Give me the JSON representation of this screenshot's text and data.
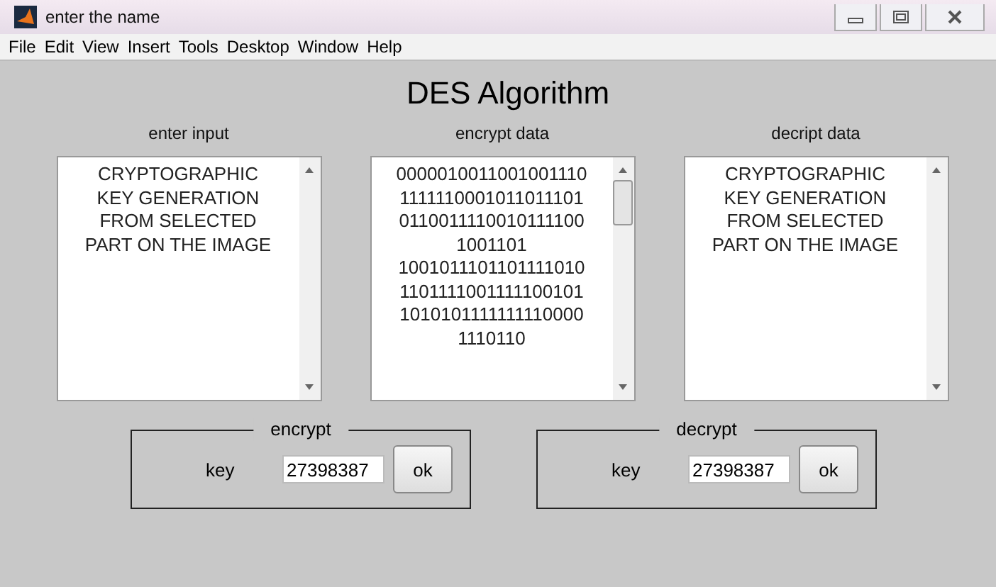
{
  "window": {
    "title": "enter the name"
  },
  "menu": [
    "File",
    "Edit",
    "View",
    "Insert",
    "Tools",
    "Desktop",
    "Window",
    "Help"
  ],
  "heading": "DES Algorithm",
  "panels": [
    {
      "label": "enter input",
      "lines": [
        "CRYPTOGRAPHIC",
        "KEY GENERATION",
        "FROM SELECTED",
        "PART ON THE IMAGE"
      ],
      "scroll_thumb": false
    },
    {
      "label": "encrypt data",
      "lines": [
        "0000010011001001110",
        "1111110001011011101",
        "0110011110010111100",
        "1001101",
        "1001011101101111010",
        "1101111001111100101",
        "1010101111111110000",
        "1110110"
      ],
      "scroll_thumb": true
    },
    {
      "label": "decript data",
      "lines": [
        "CRYPTOGRAPHIC",
        "KEY GENERATION",
        "FROM SELECTED",
        "PART ON THE IMAGE"
      ],
      "scroll_thumb": false
    }
  ],
  "groups": [
    {
      "title": "encrypt",
      "key_label": "key",
      "key_value": "27398387",
      "button": "ok"
    },
    {
      "title": "decrypt",
      "key_label": "key",
      "key_value": "27398387",
      "button": "ok"
    }
  ]
}
